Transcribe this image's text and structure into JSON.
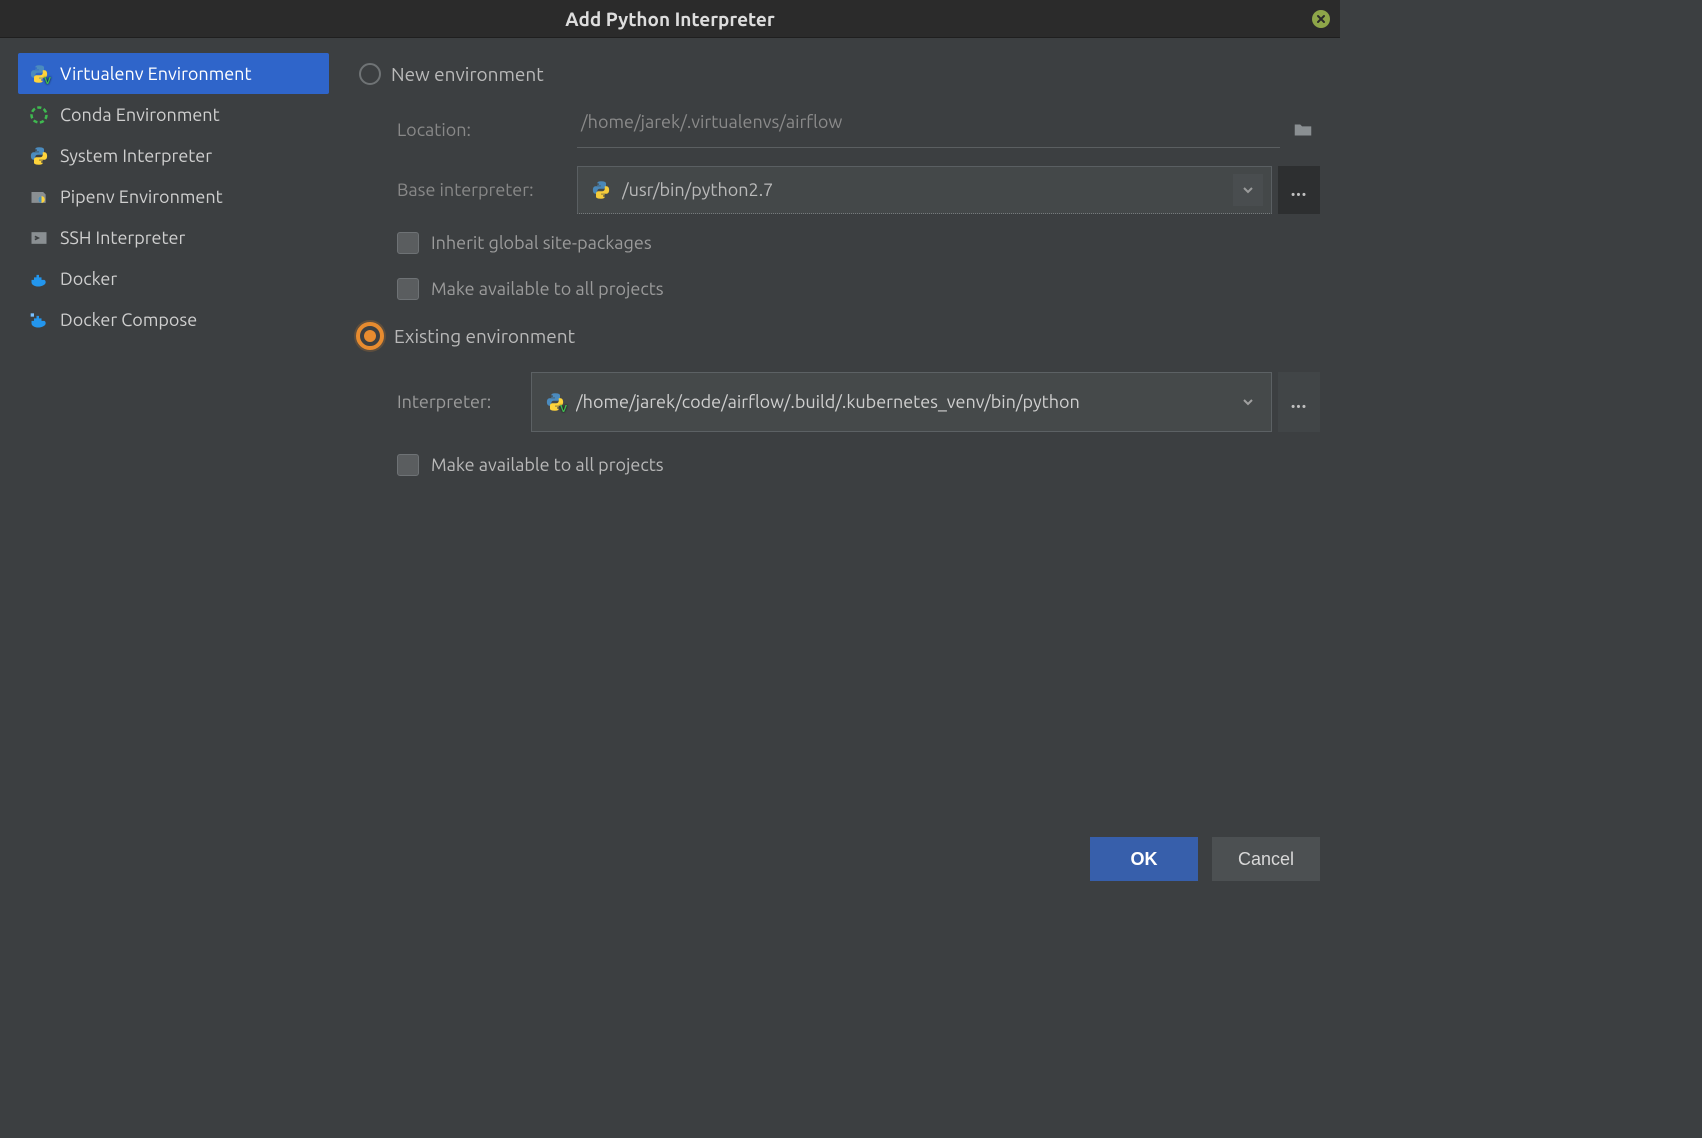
{
  "title": "Add Python Interpreter",
  "sidebar": {
    "items": [
      {
        "label": "Virtualenv Environment"
      },
      {
        "label": "Conda Environment"
      },
      {
        "label": "System Interpreter"
      },
      {
        "label": "Pipenv Environment"
      },
      {
        "label": "SSH Interpreter"
      },
      {
        "label": "Docker"
      },
      {
        "label": "Docker Compose"
      }
    ]
  },
  "new_env": {
    "radio_label": "New environment",
    "location_label": "Location:",
    "location_value": "/home/jarek/.virtualenvs/airflow",
    "base_label": "Base interpreter:",
    "base_value": "/usr/bin/python2.7",
    "inherit_label": "Inherit global site-packages",
    "make_available_label": "Make available to all projects"
  },
  "existing_env": {
    "radio_label": "Existing environment",
    "interpreter_label": "Interpreter:",
    "interpreter_value": "/home/jarek/code/airflow/.build/.kubernetes_venv/bin/python",
    "make_available_label": "Make available to all projects"
  },
  "footer": {
    "ok": "OK",
    "cancel": "Cancel"
  }
}
